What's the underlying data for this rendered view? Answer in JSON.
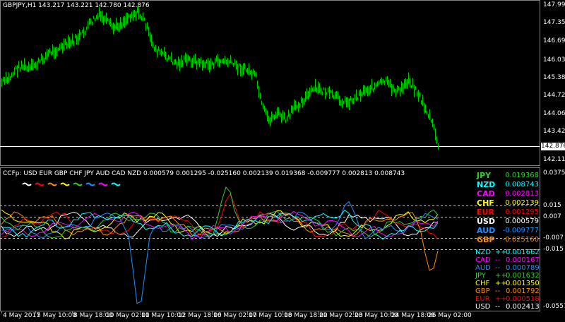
{
  "main_chart": {
    "title": "GBPJPY,H1  143.217 143.221 142.780 142.876",
    "price_axis": [
      "147.995",
      "147.355",
      "146.694",
      "146.034",
      "145.385",
      "144.725",
      "144.064",
      "143.424",
      "142.876",
      "142.119"
    ],
    "current_price": "142.876",
    "candle_color": "#00c800",
    "price_line_color": "#ffffff"
  },
  "indicator": {
    "title": "CCFp:  USD EUR GBP CHF JPY AUD CAD NZD 0.000579 0.001295 -0.025160 0.002139 0.019368 -0.009777 0.002813 0.008743",
    "legend_colors": [
      "#ffffff",
      "#ff0000",
      "#ff8c00",
      "#ffff00",
      "#32cd32",
      "#1e90ff",
      "#ff00ff",
      "#00ffff"
    ],
    "axis": [
      "0.037504",
      "0.015",
      "0.007",
      "-0.007",
      "-0.015",
      "-0.055747"
    ],
    "ranking": [
      {
        "cur": "JPY",
        "val": "0.019368",
        "color": "#32cd32"
      },
      {
        "cur": "NZD",
        "val": "0.008743",
        "color": "#00ffff"
      },
      {
        "cur": "CAD",
        "val": "0.002813",
        "color": "#ff00ff"
      },
      {
        "cur": "CHF",
        "val": "0.002139",
        "color": "#ffff00"
      },
      {
        "cur": "EUR",
        "val": "0.001295",
        "color": "#ff0000"
      },
      {
        "cur": "USD",
        "val": "0.000579",
        "color": "#ffffff"
      },
      {
        "cur": "AUD",
        "val": "-0.009777",
        "color": "#1e90ff"
      },
      {
        "cur": "GBP",
        "val": "-0.025160",
        "color": "#ff8c00"
      }
    ],
    "changes": [
      {
        "cur": "NZD",
        "sign": "++",
        "val": "0.001662",
        "color": "#00ffff"
      },
      {
        "cur": "CAD",
        "sign": "--",
        "val": "0.000167",
        "color": "#ff00ff"
      },
      {
        "cur": "AUD",
        "sign": "--",
        "val": "0.000789",
        "color": "#1e90ff"
      },
      {
        "cur": "JPY",
        "sign": "++",
        "val": "0.001632",
        "color": "#32cd32"
      },
      {
        "cur": "CHF",
        "sign": "++",
        "val": "0.001350",
        "color": "#ffff00"
      },
      {
        "cur": "GBP",
        "sign": "--",
        "val": "0.001792",
        "color": "#ff8c00"
      },
      {
        "cur": "EUR",
        "sign": "++",
        "val": "0.000518",
        "color": "#ff0000"
      },
      {
        "cur": "USD",
        "sign": "--",
        "val": "0.002413",
        "color": "#ffffff"
      }
    ]
  },
  "time_axis": [
    "4 May 2017",
    "5 May 10:00",
    "8 May 18:00",
    "10 May 02:00",
    "11 May 10:00",
    "12 May 18:00",
    "16 May 02:00",
    "17 May 10:00",
    "18 May 18:00",
    "22 May 02:00",
    "23 May 10:00",
    "24 May 18:00",
    "26 May 02:00"
  ]
}
